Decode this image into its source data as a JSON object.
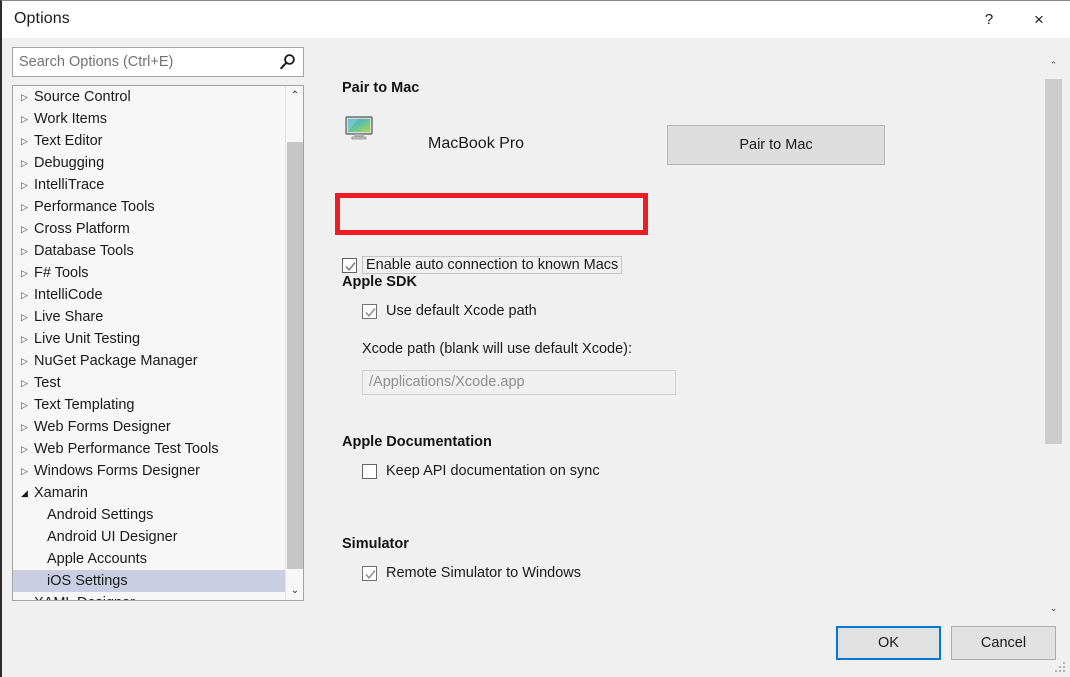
{
  "window": {
    "title": "Options",
    "help_label": "?",
    "close_label": "×"
  },
  "search": {
    "placeholder": "Search Options (Ctrl+E)",
    "value": "",
    "icon": "search-icon"
  },
  "tree": {
    "items": [
      {
        "label": "Source Control",
        "level": 0,
        "state": "collapsed",
        "selected": false
      },
      {
        "label": "Work Items",
        "level": 0,
        "state": "collapsed",
        "selected": false
      },
      {
        "label": "Text Editor",
        "level": 0,
        "state": "collapsed",
        "selected": false
      },
      {
        "label": "Debugging",
        "level": 0,
        "state": "collapsed",
        "selected": false
      },
      {
        "label": "IntelliTrace",
        "level": 0,
        "state": "collapsed",
        "selected": false
      },
      {
        "label": "Performance Tools",
        "level": 0,
        "state": "collapsed",
        "selected": false
      },
      {
        "label": "Cross Platform",
        "level": 0,
        "state": "collapsed",
        "selected": false
      },
      {
        "label": "Database Tools",
        "level": 0,
        "state": "collapsed",
        "selected": false
      },
      {
        "label": "F# Tools",
        "level": 0,
        "state": "collapsed",
        "selected": false
      },
      {
        "label": "IntelliCode",
        "level": 0,
        "state": "collapsed",
        "selected": false
      },
      {
        "label": "Live Share",
        "level": 0,
        "state": "collapsed",
        "selected": false
      },
      {
        "label": "Live Unit Testing",
        "level": 0,
        "state": "collapsed",
        "selected": false
      },
      {
        "label": "NuGet Package Manager",
        "level": 0,
        "state": "collapsed",
        "selected": false
      },
      {
        "label": "Test",
        "level": 0,
        "state": "collapsed",
        "selected": false
      },
      {
        "label": "Text Templating",
        "level": 0,
        "state": "collapsed",
        "selected": false
      },
      {
        "label": "Web Forms Designer",
        "level": 0,
        "state": "collapsed",
        "selected": false
      },
      {
        "label": "Web Performance Test Tools",
        "level": 0,
        "state": "collapsed",
        "selected": false
      },
      {
        "label": "Windows Forms Designer",
        "level": 0,
        "state": "collapsed",
        "selected": false
      },
      {
        "label": "Xamarin",
        "level": 0,
        "state": "expanded",
        "selected": false
      },
      {
        "label": "Android Settings",
        "level": 1,
        "state": "leaf",
        "selected": false
      },
      {
        "label": "Android UI Designer",
        "level": 1,
        "state": "leaf",
        "selected": false
      },
      {
        "label": "Apple Accounts",
        "level": 1,
        "state": "leaf",
        "selected": false
      },
      {
        "label": "iOS Settings",
        "level": 1,
        "state": "leaf",
        "selected": true
      },
      {
        "label": "XAML Designer",
        "level": 0,
        "state": "collapsed",
        "selected": false
      }
    ],
    "collapsed_glyph": "▷",
    "expanded_glyph": "◢",
    "scroll_up_glyph": "⌃",
    "scroll_down_glyph": "⌄"
  },
  "content": {
    "pair_to_mac": {
      "heading": "Pair to Mac",
      "device_icon": "monitor-icon",
      "device_name": "MacBook Pro",
      "button_label": "Pair to Mac",
      "auto_connect": {
        "label": "Enable auto connection to known Macs",
        "checked": true,
        "focused": true
      }
    },
    "apple_sdk": {
      "heading": "Apple SDK",
      "use_default_xcode": {
        "label": "Use default Xcode path",
        "checked": true
      },
      "path_label": "Xcode path (blank will use default Xcode):",
      "path_placeholder": "/Applications/Xcode.app",
      "path_value": ""
    },
    "apple_documentation": {
      "heading": "Apple Documentation",
      "keep_api_docs": {
        "label": "Keep API documentation on sync",
        "checked": false
      }
    },
    "simulator": {
      "heading": "Simulator",
      "remote_simulator": {
        "label": "Remote Simulator to Windows",
        "checked": true
      }
    }
  },
  "footer": {
    "ok_label": "OK",
    "cancel_label": "Cancel"
  },
  "annotation": {
    "color": "#ee1c24",
    "target": "enable-auto-connection-checkbox"
  },
  "colors": {
    "dialog_background": "#f0f0f0",
    "titlebar_background": "#ffffff",
    "tree_background": "#f7f7f7",
    "selection": "#c9cee2",
    "focus_border": "#0078d7",
    "annotation_red": "#ee1c24"
  }
}
